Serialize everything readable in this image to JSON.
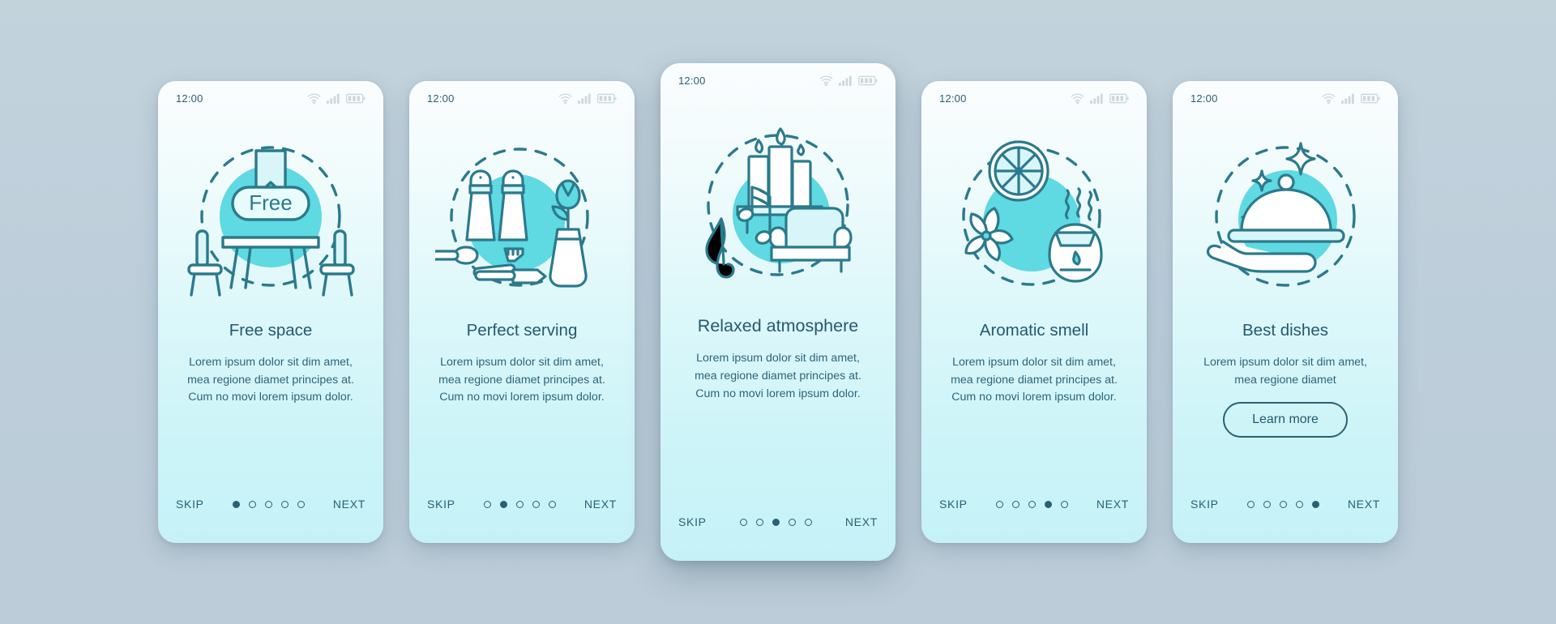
{
  "screens": [
    {
      "status": {
        "time": "12:00",
        "wifi_icon": "wifi-icon",
        "signal_icon": "cellular-signal-icon",
        "battery_icon": "battery-icon"
      },
      "illustration": "free-space-illustration",
      "illustration_label": "Free",
      "title": "Free space",
      "body": "Lorem ipsum dolor sit dim amet, mea regione diamet principes at. Cum no movi lorem ipsum dolor.",
      "skip_label": "SKIP",
      "next_label": "NEXT",
      "dots_total": 5,
      "dot_active": 0,
      "cta": null
    },
    {
      "status": {
        "time": "12:00",
        "wifi_icon": "wifi-icon",
        "signal_icon": "cellular-signal-icon",
        "battery_icon": "battery-icon"
      },
      "illustration": "perfect-serving-illustration",
      "illustration_label": "",
      "title": "Perfect serving",
      "body": "Lorem ipsum dolor sit dim amet, mea regione diamet principes at. Cum no movi lorem ipsum dolor.",
      "skip_label": "SKIP",
      "next_label": "NEXT",
      "dots_total": 5,
      "dot_active": 1,
      "cta": null
    },
    {
      "status": {
        "time": "12:00",
        "wifi_icon": "wifi-icon",
        "signal_icon": "cellular-signal-icon",
        "battery_icon": "battery-icon"
      },
      "illustration": "relaxed-atmosphere-illustration",
      "illustration_label": "",
      "title": "Relaxed atmosphere",
      "body": "Lorem ipsum dolor sit dim amet, mea regione diamet principes at. Cum no movi lorem ipsum dolor.",
      "skip_label": "SKIP",
      "next_label": "NEXT",
      "dots_total": 5,
      "dot_active": 2,
      "cta": null
    },
    {
      "status": {
        "time": "12:00",
        "wifi_icon": "wifi-icon",
        "signal_icon": "cellular-signal-icon",
        "battery_icon": "battery-icon"
      },
      "illustration": "aromatic-smell-illustration",
      "illustration_label": "",
      "title": "Aromatic smell",
      "body": "Lorem ipsum dolor sit dim amet, mea regione diamet principes at. Cum no movi lorem ipsum dolor.",
      "skip_label": "SKIP",
      "next_label": "NEXT",
      "dots_total": 5,
      "dot_active": 3,
      "cta": null
    },
    {
      "status": {
        "time": "12:00",
        "wifi_icon": "wifi-icon",
        "signal_icon": "cellular-signal-icon",
        "battery_icon": "battery-icon"
      },
      "illustration": "best-dishes-illustration",
      "illustration_label": "",
      "title": "Best dishes",
      "body": "Lorem ipsum dolor sit dim amet, mea regione diamet",
      "skip_label": "SKIP",
      "next_label": "NEXT",
      "dots_total": 5,
      "dot_active": 4,
      "cta": "Learn more"
    }
  ],
  "colors": {
    "accent": "#5fd9e2",
    "line": "#2b7a8c",
    "text": "#26596e",
    "page_background": "#bdcedb",
    "card_top": "#fbfdfe",
    "card_bottom": "#c6f2f7"
  }
}
